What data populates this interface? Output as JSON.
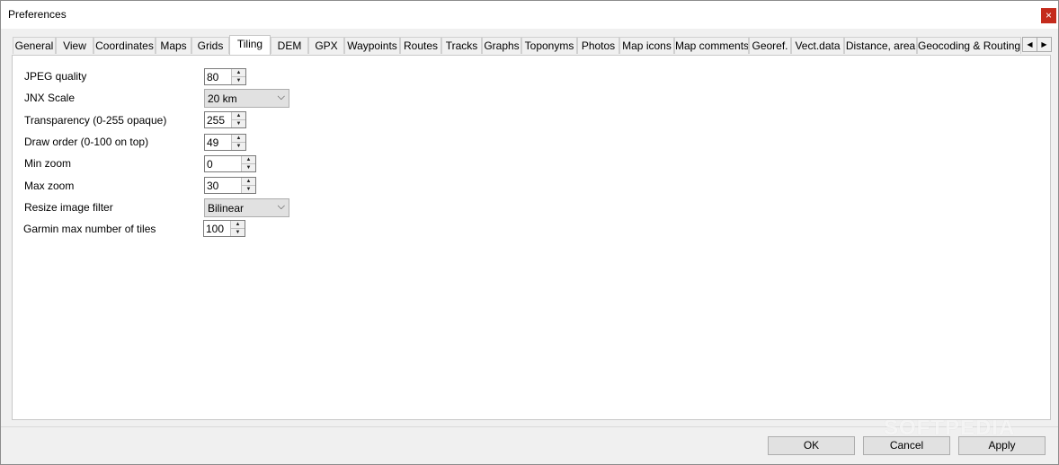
{
  "window": {
    "title": "Preferences",
    "close_glyph": "×"
  },
  "tabs": [
    {
      "label": "General"
    },
    {
      "label": "View"
    },
    {
      "label": "Coordinates"
    },
    {
      "label": "Maps"
    },
    {
      "label": "Grids"
    },
    {
      "label": "Tiling"
    },
    {
      "label": "DEM"
    },
    {
      "label": "GPX"
    },
    {
      "label": "Waypoints"
    },
    {
      "label": "Routes"
    },
    {
      "label": "Tracks"
    },
    {
      "label": "Graphs"
    },
    {
      "label": "Toponyms"
    },
    {
      "label": "Photos"
    },
    {
      "label": "Map icons"
    },
    {
      "label": "Map comments"
    },
    {
      "label": "Georef."
    },
    {
      "label": "Vect.data"
    },
    {
      "label": "Distance, area"
    },
    {
      "label": "Geocoding & Routing"
    }
  ],
  "active_tab": "Tiling",
  "tab_scroll": {
    "left_icon": "◀",
    "right_icon": "▶"
  },
  "fields": {
    "jpeg_quality": {
      "label": "JPEG quality",
      "value": "80"
    },
    "jnx_scale": {
      "label": "JNX Scale",
      "value": "20 km"
    },
    "transparency": {
      "label": "Transparency (0-255 opaque)",
      "value": "255"
    },
    "draw_order": {
      "label": "Draw order (0-100 on top)",
      "value": "49"
    },
    "min_zoom": {
      "label": "Min zoom",
      "value": "0"
    },
    "max_zoom": {
      "label": "Max zoom",
      "value": "30"
    },
    "resize_filter": {
      "label": "Resize image filter",
      "value": "Bilinear"
    },
    "garmin_max_tiles": {
      "label": "Garmin max number of tiles",
      "value": "100"
    }
  },
  "glyphs": {
    "up": "▲",
    "down": "▼",
    "chevron": "⌵"
  },
  "buttons": {
    "ok": "OK",
    "cancel": "Cancel",
    "apply": "Apply"
  },
  "watermark": "SOFTPEDIA"
}
